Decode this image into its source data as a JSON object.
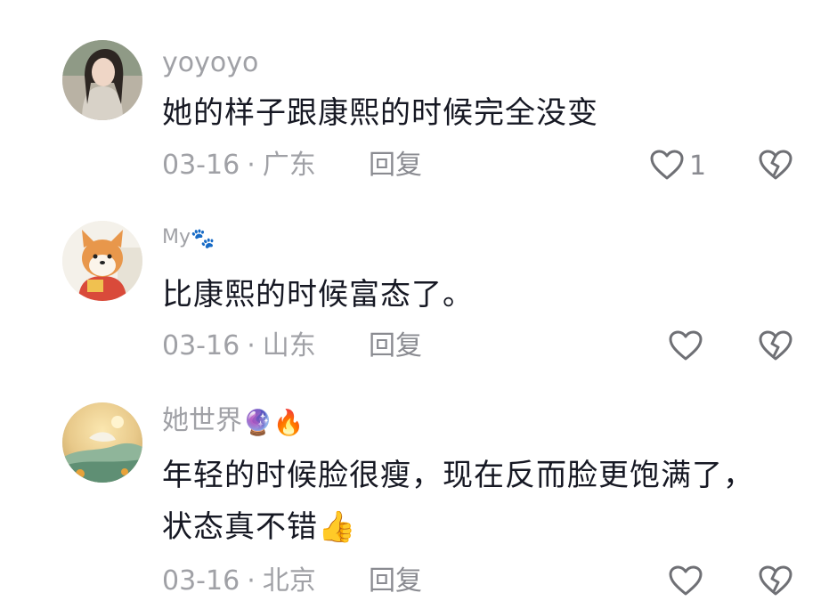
{
  "comments": [
    {
      "username": "yoyoyo",
      "username_suffix": "",
      "text_lines": [
        "她的样子跟康熙的时候完全没变"
      ],
      "date": "03-16",
      "separator": "·",
      "location": "广东",
      "reply_label": "回复",
      "like_count": "1"
    },
    {
      "username": "My",
      "username_suffix": "🐾",
      "text_lines": [
        "比康熙的时候富态了。"
      ],
      "date": "03-16",
      "separator": "·",
      "location": "山东",
      "reply_label": "回复",
      "like_count": ""
    },
    {
      "username": "她世界",
      "username_suffix": "🔮🔥",
      "text_lines": [
        "年轻的时候脸很瘦，现在反而脸更饱满了，",
        "状态真不错👍"
      ],
      "date": "03-16",
      "separator": "·",
      "location": "北京",
      "reply_label": "回复",
      "like_count": ""
    }
  ],
  "icons": {
    "like": "heart-outline-icon",
    "dislike": "broken-heart-icon"
  },
  "colors": {
    "text": "#161823",
    "meta": "#a0a1a6",
    "icon": "#6f7075"
  }
}
